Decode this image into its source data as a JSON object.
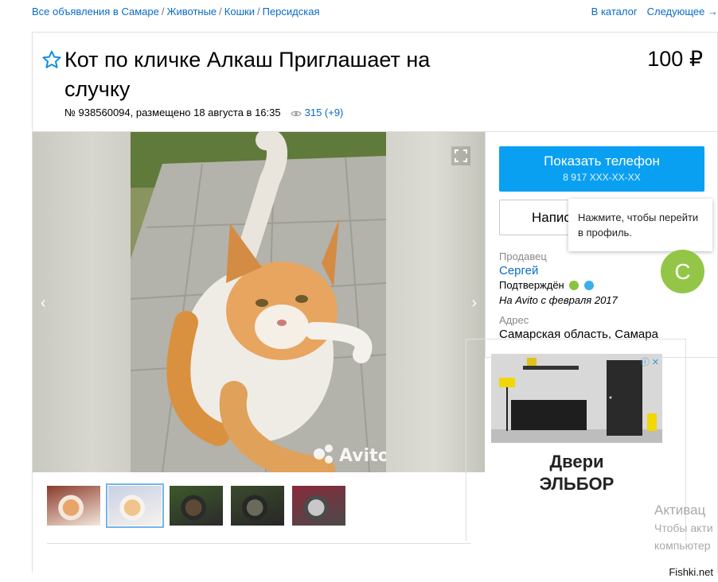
{
  "breadcrumb": {
    "items": [
      "Все объявления в Самаре",
      "Животные",
      "Кошки",
      "Персидская"
    ],
    "separator": "/"
  },
  "topnav": {
    "catalog": "В каталог",
    "next": "Следующее →"
  },
  "ad": {
    "title": "Кот по кличке Алкаш Приглашает на случку",
    "price": "100 ₽",
    "meta": "№ 938560094, размещено 18 августа в 16:35",
    "views": "315 (+9)"
  },
  "gallery": {
    "watermark": "Avito",
    "thumbnails": [
      {
        "active": false,
        "colors": [
          "#8a3a2a",
          "#e8a56a",
          "#f3e7dc"
        ]
      },
      {
        "active": true,
        "colors": [
          "#c9d1e3",
          "#f0c48a",
          "#f6f2ee"
        ]
      },
      {
        "active": false,
        "colors": [
          "#3c5a2a",
          "#5c4a35",
          "#2b2b2b"
        ]
      },
      {
        "active": false,
        "colors": [
          "#3b4a2c",
          "#6a6a5a",
          "#272727"
        ]
      },
      {
        "active": false,
        "colors": [
          "#8a2a3a",
          "#c8c8c8",
          "#4a4a4a"
        ]
      }
    ]
  },
  "seller": {
    "phone_button": "Показать телефон",
    "phone_number": "8 917 XXX-XX-XX",
    "message_button": "Написать сообщение",
    "tooltip": "Нажмите, чтобы перейти в профиль.",
    "label": "Продавец",
    "name": "Сергей",
    "confirmed": "Подтверждён",
    "since": "На Avito с февраля 2017",
    "avatar_letter": "С",
    "address_label": "Адрес",
    "address": "Самарская область, Самара"
  },
  "banner": {
    "text_line1": "Двери",
    "text_line2": "ЭЛЬБОР"
  },
  "windows_overlay": {
    "line1": "Активац",
    "line2": "Чтобы акти",
    "line3": "компьютер"
  },
  "watermark": "Fishki.net",
  "colors": {
    "link": "#0a6ac9",
    "phone_button": "#0aa0f2",
    "avatar": "#93c647"
  }
}
